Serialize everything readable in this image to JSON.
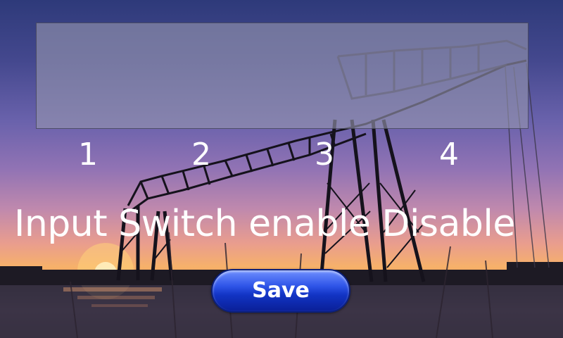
{
  "channels": [
    "1",
    "2",
    "3",
    "4"
  ],
  "status_line": "Input Switch enable Disable",
  "save_button": {
    "label": "Save"
  },
  "colors": {
    "panel_fill": "#9696af",
    "button_top": "#6f8fff",
    "button_bottom": "#0a1f96",
    "text": "#ffffff"
  },
  "background": {
    "description_icon": "bridge-scene-icon"
  }
}
